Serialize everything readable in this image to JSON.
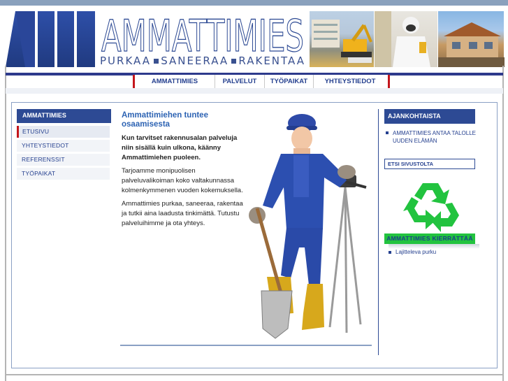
{
  "brand": {
    "title": "AMMATTIMIES",
    "tagline": [
      "PURKAA",
      "SANEERAA",
      "RAKENTAA"
    ]
  },
  "nav": {
    "items": [
      {
        "label": "AMMATTIMIES"
      },
      {
        "label": "PALVELUT"
      },
      {
        "label": "TYÖPAIKAT"
      },
      {
        "label": "YHTEYSTIEDOT"
      }
    ]
  },
  "sidebar": {
    "heading": "AMMATTIMIES",
    "items": [
      {
        "label": "ETUSIVU"
      },
      {
        "label": "YHTEYSTIEDOT"
      },
      {
        "label": "REFERENSSIT"
      },
      {
        "label": "TYÖPAIKAT"
      }
    ]
  },
  "article": {
    "title": "Ammattimiehen tuntee osaamisesta",
    "lead": "Kun tarvitset rakennusalan palveluja niin sisällä kuin ulkona, käänny Ammattimiehen puoleen.",
    "paragraphs": [
      "Tarjoamme monipuolisen palveluvalikoiman koko valtakunnassa kolmenkymmenen vuoden kokemuksella.",
      "Ammattimies purkaa, saneeraa, rakentaa ja tutkii aina laadusta tinkimättä. Tutustu palveluihimme ja ota yhteys."
    ]
  },
  "right": {
    "news_heading": "AJANKOHTAISTA",
    "news_item": "AMMATTIMIES ANTAA TALOLLE UUDEN ELÄMÄN",
    "search_label": "ETSI SIVUSTOLTA",
    "recycle_banner": "AMMATTIMIES KIERRÄTTÄÄ",
    "link": "Lajitteleva purku"
  },
  "colors": {
    "brand_blue": "#2d4a94",
    "accent_red": "#c4161c",
    "recycle_green": "#22c33f",
    "link_blue": "#25408f"
  },
  "icons": {
    "logo": "mm-logo-icon",
    "recycle": "recycle-icon"
  }
}
